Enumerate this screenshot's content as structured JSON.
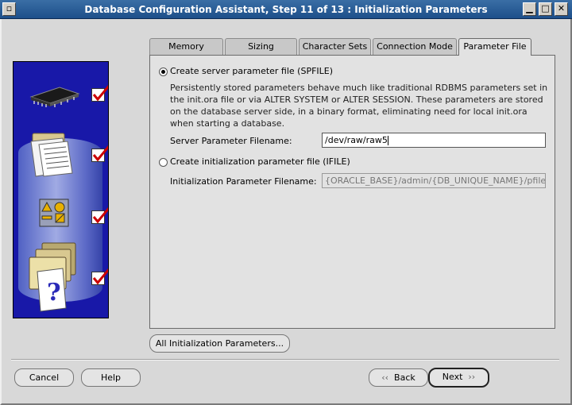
{
  "window": {
    "title": "Database Configuration Assistant, Step 11 of 13 : Initialization Parameters"
  },
  "tabs": [
    {
      "label": "Memory"
    },
    {
      "label": "Sizing"
    },
    {
      "label": "Character Sets"
    },
    {
      "label": "Connection Mode"
    },
    {
      "label": "Parameter File"
    }
  ],
  "panel": {
    "spfile_option": "Create server parameter file (SPFILE)",
    "spfile_description": "Persistently stored parameters behave much like traditional RDBMS parameters set in the init.ora file or via ALTER SYSTEM or ALTER SESSION. These parameters are stored on the database server side, in a binary format, eliminating need for local init.ora when starting a database.",
    "server_param_label": "Server Parameter Filename:",
    "server_param_value": "/dev/raw/raw5",
    "ifile_option": "Create initialization parameter file (IFILE)",
    "init_param_label": "Initialization Parameter Filename:",
    "init_param_value": "{ORACLE_BASE}/admin/{DB_UNIQUE_NAME}/pfile/ini"
  },
  "buttons": {
    "all_params": "All Initialization Parameters...",
    "cancel": "Cancel",
    "help": "Help",
    "back": "Back",
    "next": "Next"
  },
  "colors": {
    "titlebar": "#1d4f8a",
    "leftpanel": "#1818a8",
    "check_mark": "#cc0000"
  }
}
